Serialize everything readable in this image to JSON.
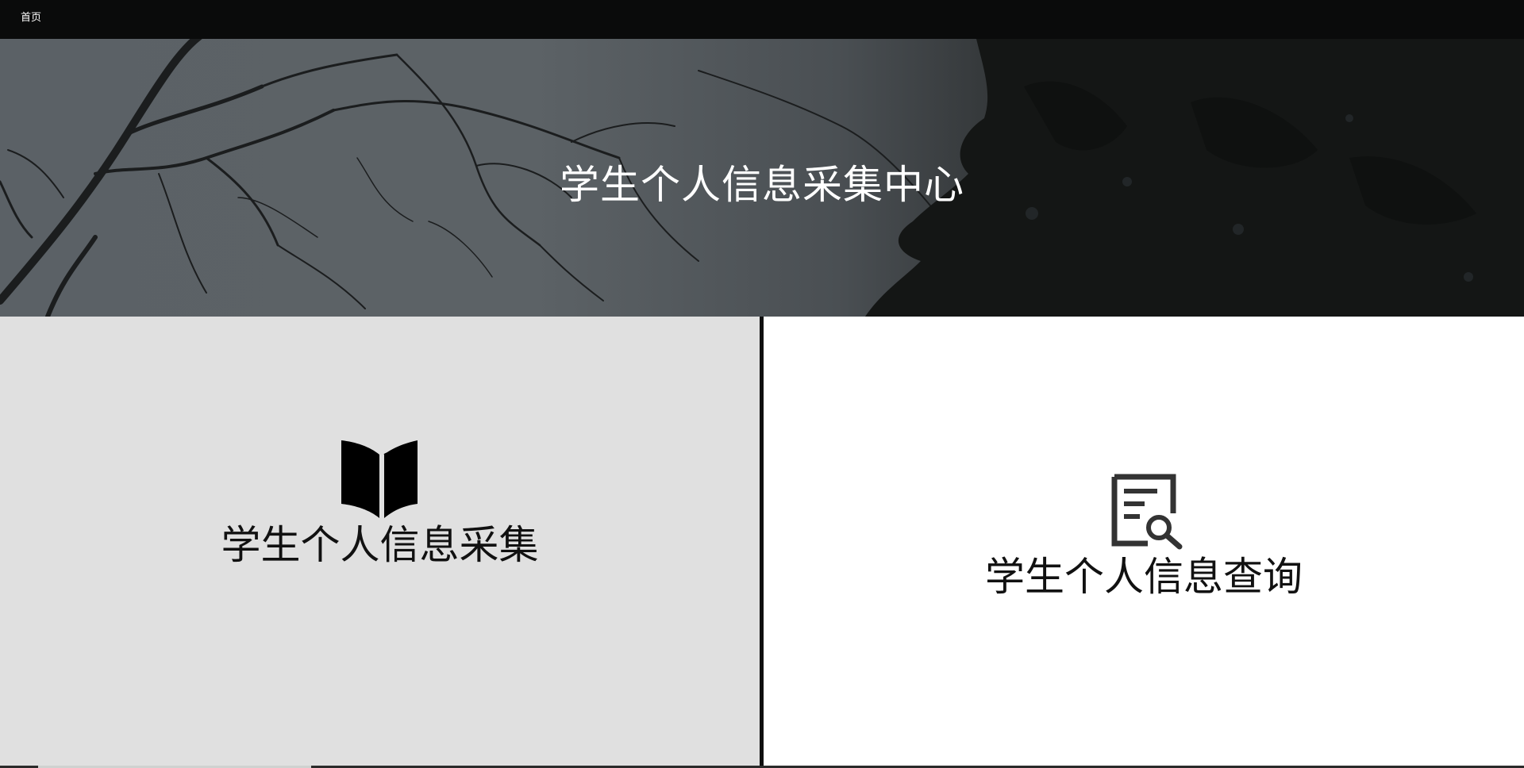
{
  "nav": {
    "home_label": "首页"
  },
  "hero": {
    "title": "学生个人信息采集中心"
  },
  "panels": [
    {
      "label": "学生个人信息采集",
      "icon": "book-open-icon",
      "background": "#e0e0e0"
    },
    {
      "label": "学生个人信息查询",
      "icon": "document-search-icon",
      "background": "#ffffff"
    }
  ],
  "colors": {
    "topbar": "#0a0b0b",
    "divider": "#0f0f0f",
    "hero_text": "#ffffff",
    "panel_text": "#111111"
  }
}
